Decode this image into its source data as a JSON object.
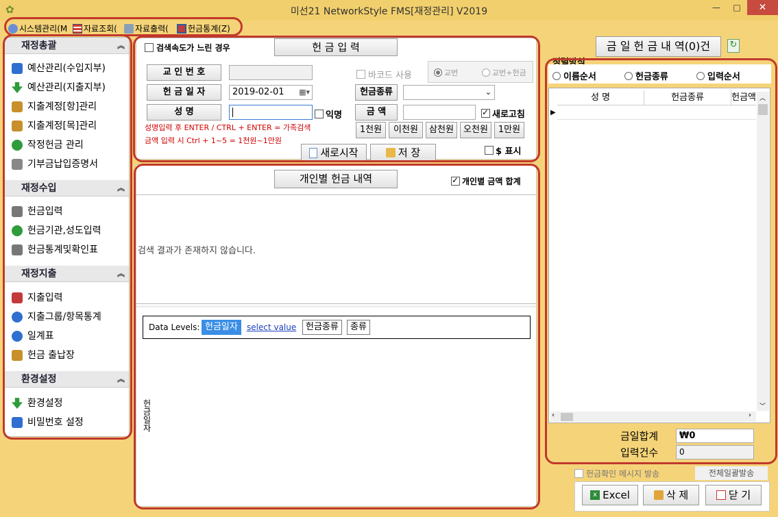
{
  "window": {
    "title": "미선21 NetworkStyle FMS[재정관리] V2019",
    "minimize": "—",
    "maximize": "□",
    "close": "✕"
  },
  "menu": {
    "items": [
      {
        "label": "시스템관리(M",
        "icon": "system-icon"
      },
      {
        "label": "자료조회(",
        "icon": "table-icon"
      },
      {
        "label": "자료출력(",
        "icon": "printer-icon"
      },
      {
        "label": "헌금통계(Z)",
        "icon": "chart-icon"
      }
    ]
  },
  "sidebar": {
    "sections": [
      {
        "title": "재정총괄",
        "items": [
          "예산관리(수입지부)",
          "예산관리(지출지부)",
          "지출계정[항]관리",
          "지출계정[목]관리",
          "작정헌금 관리",
          "기부금납입증명서"
        ]
      },
      {
        "title": "재정수입",
        "items": [
          "헌금입력",
          "헌금기관,성도입력",
          "헌금통계및확인표"
        ]
      },
      {
        "title": "재정지출",
        "items": [
          "지출입력",
          "지출그룹/항목통계",
          "일계표",
          "헌금 출납장"
        ]
      },
      {
        "title": "환경설정",
        "items": [
          "환경설정",
          "비밀번호 설정"
        ]
      }
    ]
  },
  "entry": {
    "slow_search_label": "검색속도가 느린 경우",
    "header_button": "헌 금 입 력",
    "church_no_label": "교 인 번 호",
    "date_label": "헌 금 일 자",
    "date_value": "2019-02-01",
    "name_label": "성        명",
    "anonymous_label": "익명",
    "barcode_label": "바코드 사용",
    "radio_gyobeon": "교번",
    "radio_gyobeon_amount": "교번+헌금",
    "type_label": "헌금종류",
    "amount_label": "금    액",
    "refresh_label": "새로고침",
    "note1": "성명입력 후 ENTER / CTRL + ENTER = 가족검색",
    "note2": "금액 입력 시 Ctrl + 1~5 = 1천원~1만원",
    "quick_amounts": [
      "1천원",
      "이천원",
      "삼천원",
      "오천원",
      "1만원"
    ],
    "new_start": "새로시작",
    "save": "저    장",
    "dollar_label": "$ 표시"
  },
  "personal": {
    "header_button": "개인별 헌금 내역",
    "sum_label": "개인별 금액 합계",
    "empty_message": "검색 결과가 존재하지 않습니다.",
    "pivot_label": "Data Levels:",
    "pivot_levels": [
      "헌금일자",
      "select value",
      "헌금종류",
      "종류"
    ],
    "axis_label": "헌금일자"
  },
  "right": {
    "header_button": "금 일 헌 금 내 역(0)건",
    "sort_label": "정렬방식",
    "sort_options": [
      "이름순서",
      "헌금종류",
      "입력순서"
    ],
    "columns": [
      "성    명",
      "헌금종류",
      "헌금액"
    ],
    "total_label": "금일합계",
    "total_value": "₩0",
    "count_label": "입력건수",
    "count_value": "0",
    "msg_label": "헌금확인 메시지 발송",
    "bulk_label": "전체일괄발송",
    "excel": "Excel",
    "delete": "삭 제",
    "close": "닫 기"
  }
}
